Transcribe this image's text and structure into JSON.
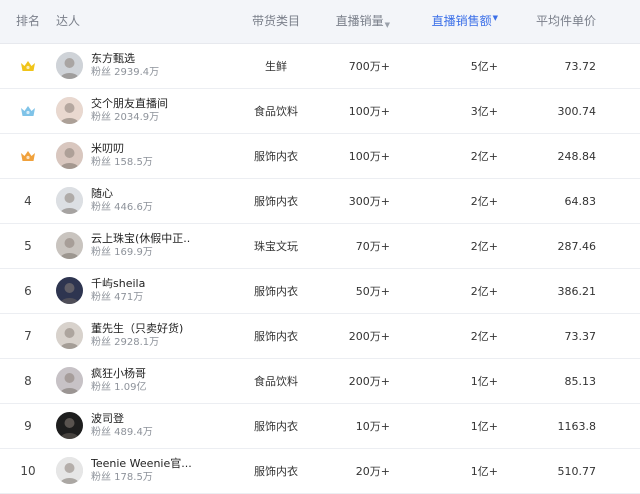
{
  "header": {
    "rank": "排名",
    "influencer": "达人",
    "category": "带货类目",
    "live_volume": "直播销量",
    "live_amount": "直播销售额",
    "avg_price": "平均件单价"
  },
  "colors": {
    "accent": "#3b6fe8",
    "gold": "#f0c419",
    "silver": "#7fc3e8",
    "bronze": "#f0a13c"
  },
  "rows": [
    {
      "rank": "",
      "medal": "gold-medal-icon",
      "name": "东方甄选",
      "fans": "粉丝 2939.4万",
      "category": "生鲜",
      "volume": "700万+",
      "amount": "5亿+",
      "avg": "73.72"
    },
    {
      "rank": "",
      "medal": "silver-medal-icon",
      "name": "交个朋友直播间",
      "fans": "粉丝 2034.9万",
      "category": "食品饮料",
      "volume": "100万+",
      "amount": "3亿+",
      "avg": "300.74"
    },
    {
      "rank": "",
      "medal": "bronze-medal-icon",
      "name": "米叨叨",
      "fans": "粉丝 158.5万",
      "category": "服饰内衣",
      "volume": "100万+",
      "amount": "2亿+",
      "avg": "248.84"
    },
    {
      "rank": "4",
      "medal": "",
      "name": "随心",
      "fans": "粉丝 446.6万",
      "category": "服饰内衣",
      "volume": "300万+",
      "amount": "2亿+",
      "avg": "64.83"
    },
    {
      "rank": "5",
      "medal": "",
      "name": "云上珠宝(休假中正...",
      "fans": "粉丝 169.9万",
      "category": "珠宝文玩",
      "volume": "70万+",
      "amount": "2亿+",
      "avg": "287.46"
    },
    {
      "rank": "6",
      "medal": "",
      "name": "千屿sheila",
      "fans": "粉丝 471万",
      "category": "服饰内衣",
      "volume": "50万+",
      "amount": "2亿+",
      "avg": "386.21"
    },
    {
      "rank": "7",
      "medal": "",
      "name": "董先生（只卖好货)",
      "fans": "粉丝 2928.1万",
      "category": "服饰内衣",
      "volume": "200万+",
      "amount": "2亿+",
      "avg": "73.37"
    },
    {
      "rank": "8",
      "medal": "",
      "name": "疯狂小杨哥",
      "fans": "粉丝 1.09亿",
      "category": "食品饮料",
      "volume": "200万+",
      "amount": "1亿+",
      "avg": "85.13"
    },
    {
      "rank": "9",
      "medal": "",
      "name": "波司登",
      "fans": "粉丝 489.4万",
      "category": "服饰内衣",
      "volume": "10万+",
      "amount": "1亿+",
      "avg": "1163.8"
    },
    {
      "rank": "10",
      "medal": "",
      "name": "Teenie Weenie官...",
      "fans": "粉丝 178.5万",
      "category": "服饰内衣",
      "volume": "20万+",
      "amount": "1亿+",
      "avg": "510.77"
    }
  ]
}
